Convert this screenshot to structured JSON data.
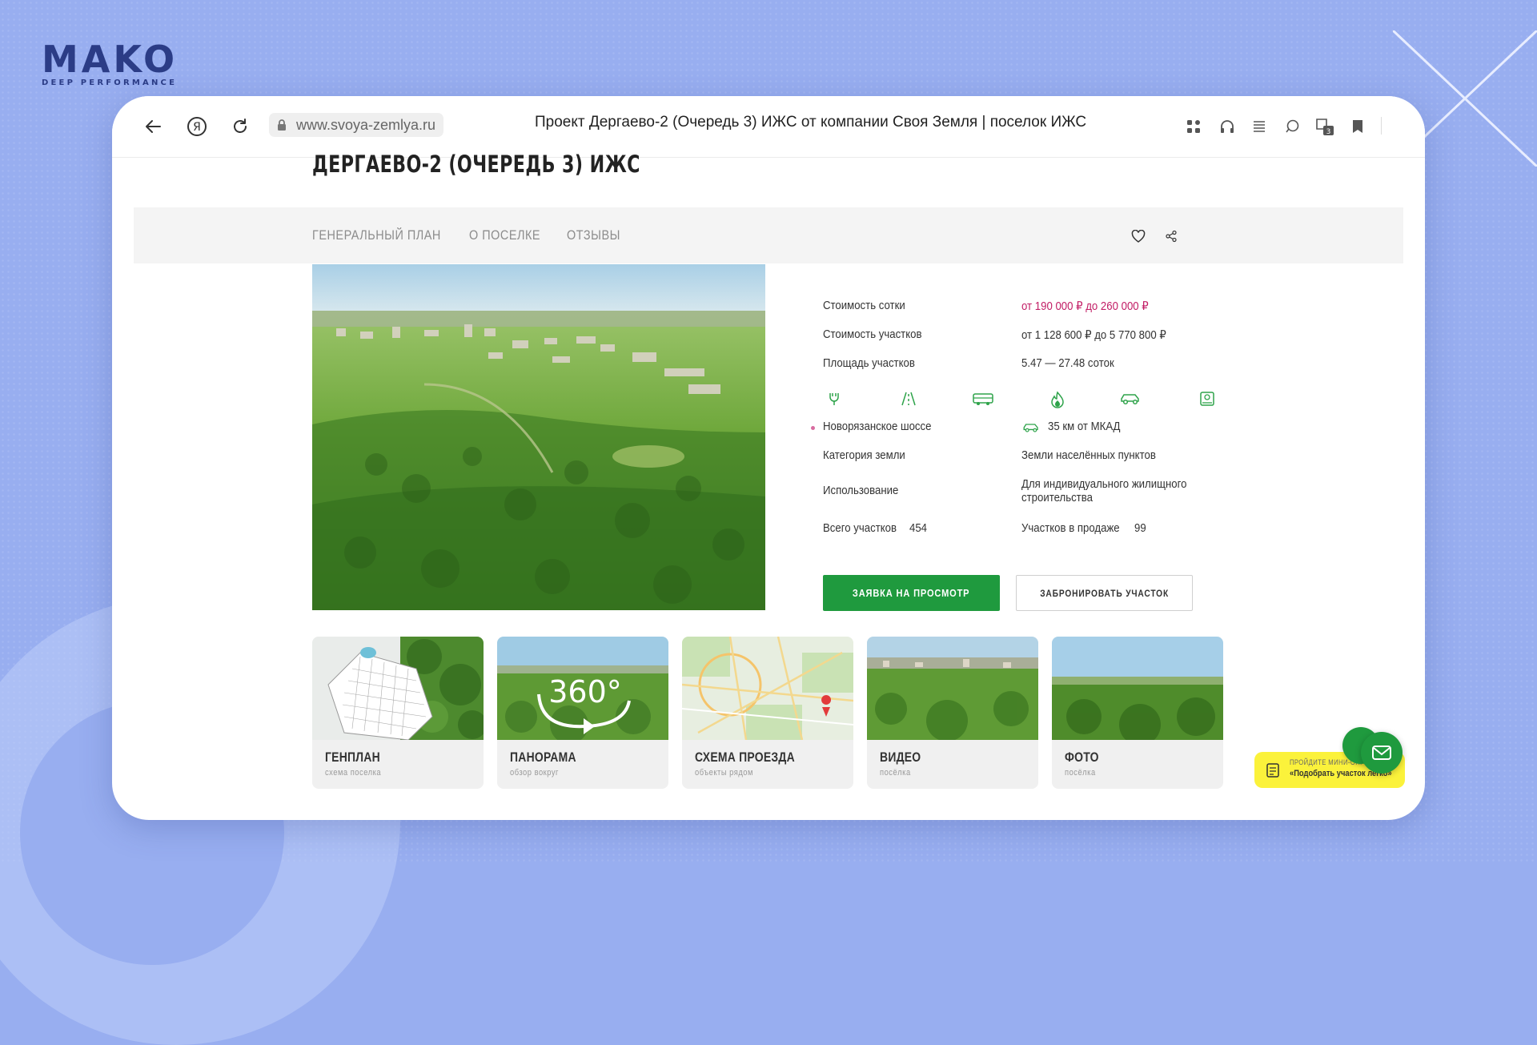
{
  "brand": {
    "name": "MAKO",
    "tagline": "DEEP PERFORMANCE"
  },
  "browser": {
    "url": "www.svoya-zemlya.ru",
    "page_title": "Проект Дергаево-2 (Очередь 3) ИЖС от компании Своя Земля | поселок ИЖС",
    "tabs_badge": "3",
    "icons": [
      "back-arrow-icon",
      "yandex-icon",
      "reload-icon",
      "lock-icon",
      "apps-icon",
      "headphones-icon",
      "reader-icon",
      "chat-icon",
      "tabs-icon",
      "bookmark-icon"
    ]
  },
  "page": {
    "heading": "ДЕРГАЕВО-2 (ОЧЕРЕДЬ 3) ИЖС",
    "tabs": [
      {
        "label": "ГЕНЕРАЛЬНЫЙ ПЛАН"
      },
      {
        "label": "О ПОСЕЛКЕ"
      },
      {
        "label": "ОТЗЫВЫ"
      }
    ]
  },
  "info": {
    "price_per_sotka": {
      "label": "Стоимость сотки",
      "value": "от 190 000 ₽ до 260 000 ₽"
    },
    "plot_price": {
      "label": "Стоимость участков",
      "value": "от 1 128 600 ₽ до 5 770 800 ₽"
    },
    "plot_area": {
      "label": "Площадь участков",
      "value": "5.47 — 27.48 соток"
    },
    "amenity_icons": [
      "electricity-icon",
      "road-icon",
      "bus-icon",
      "gas-icon",
      "car-icon",
      "security-icon"
    ],
    "highway": {
      "label": "Новорязанское шоссе",
      "value": "35 км от МКАД"
    },
    "land_category": {
      "label": "Категория земли",
      "value": "Земли населённых пунктов"
    },
    "usage": {
      "label": "Использование",
      "value": "Для индивидуального жилищного",
      "value2": "строительства"
    },
    "total_plots": {
      "label": "Всего участков",
      "value": "454"
    },
    "plots_on_sale": {
      "label": "Участков в продаже",
      "value": "99"
    }
  },
  "buttons": {
    "request_view": "ЗАЯВКА НА ПРОСМОТР",
    "book_plot": "ЗАБРОНИРОВАТЬ УЧАСТОК"
  },
  "cards": [
    {
      "title": "ГЕНПЛАН",
      "subtitle": "схема поселка"
    },
    {
      "title": "ПАНОРАМА",
      "subtitle": "обзор вокруг",
      "overlay": "360°"
    },
    {
      "title": "СХЕМА ПРОЕЗДА",
      "subtitle": "объекты рядом"
    },
    {
      "title": "ВИДЕО",
      "subtitle": "посёлка"
    },
    {
      "title": "ФОТО",
      "subtitle": "посёлка"
    }
  ],
  "promo": {
    "top": "ПРОЙДИТЕ МИНИ-ОПРОС",
    "main": "«Подобрать участок легко»"
  },
  "colors": {
    "accent_green": "#1f9a3e",
    "price_pink": "#c21e66",
    "background": "#98aef0",
    "promo_yellow": "#fbf23b"
  }
}
